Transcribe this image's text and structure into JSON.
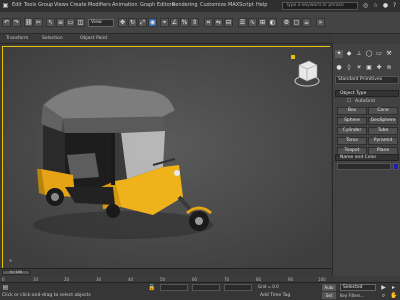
{
  "menubar": {
    "items": [
      "Edit",
      "Tools",
      "Group",
      "Views",
      "Create",
      "Modifiers",
      "Animation",
      "Graph Editors",
      "Rendering",
      "Customize",
      "MAXScript",
      "Help"
    ],
    "search_placeholder": "Type a keyword or phrase"
  },
  "toolbar": {
    "view_dropdown": "View"
  },
  "ribbon": {
    "items": [
      "Transform",
      "Selection",
      "Object Paint"
    ]
  },
  "command_panel": {
    "category": "Standard Primitives",
    "object_type_header": "Object Type",
    "autogrid_label": "AutoGrid",
    "buttons": [
      "Box",
      "Cone",
      "Sphere",
      "GeoSphere",
      "Cylinder",
      "Tube",
      "Torus",
      "Pyramid",
      "Teapot",
      "Plane"
    ],
    "name_color_header": "Name and Color"
  },
  "timeline": {
    "frame_label": "0 / 100",
    "tick_labels": [
      "0",
      "10",
      "20",
      "30",
      "40",
      "50",
      "60",
      "70",
      "80",
      "90",
      "100"
    ]
  },
  "statusbar": {
    "status_text": "Click or click-and-drag to select objects",
    "grid_label": "Grid = 0.0",
    "add_time_tag": "Add Time Tag",
    "auto_key": "Auto Key",
    "set_key": "Set Key",
    "selected_label": "Selected",
    "key_filters": "Key Filters..."
  },
  "colors": {
    "viewport_border": "#e6c300",
    "object_color": "#1b1eb8"
  }
}
